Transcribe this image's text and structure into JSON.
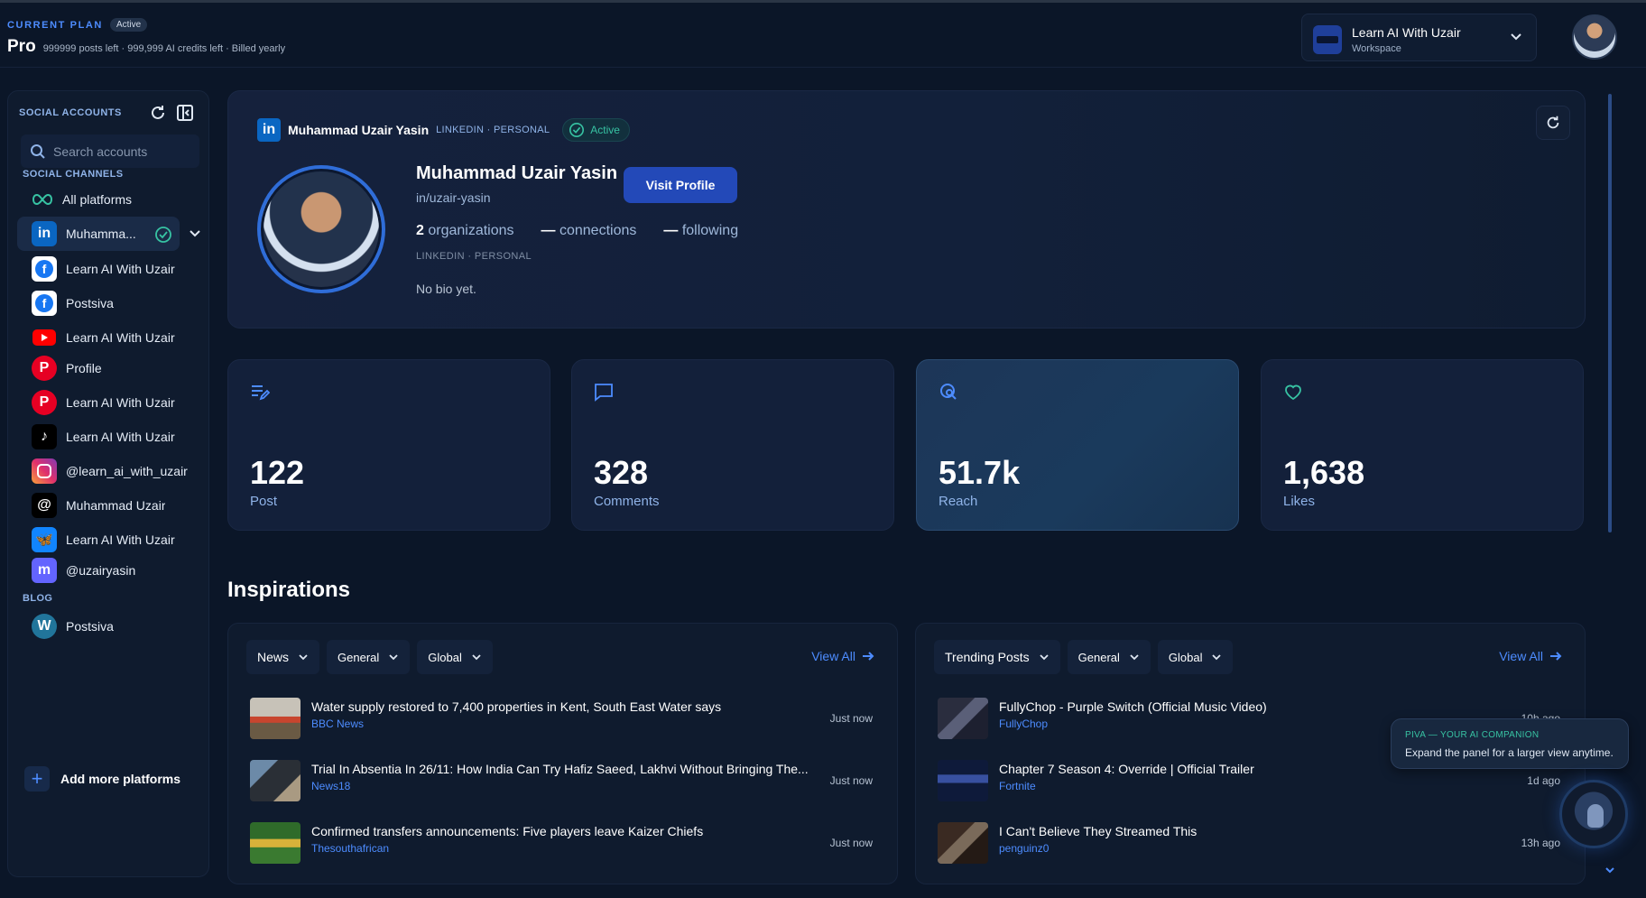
{
  "plan": {
    "eyebrow": "CURRENT PLAN",
    "status": "Active",
    "name": "Pro",
    "meta": "999999 posts left · 999,999 AI credits left · Billed yearly"
  },
  "workspace": {
    "name": "Learn AI With Uzair",
    "label": "Workspace"
  },
  "sidebar": {
    "title": "SOCIAL ACCOUNTS",
    "search_placeholder": "Search accounts",
    "channels_label": "SOCIAL CHANNELS",
    "all_platforms": "All platforms",
    "accounts": [
      {
        "name": "Muhamma...",
        "platform": "linkedin",
        "icon": "linkedin-icon",
        "selected": true
      },
      {
        "name": "Learn AI With Uzair",
        "platform": "facebook",
        "icon": "facebook-icon"
      },
      {
        "name": "Postsiva",
        "platform": "facebook",
        "icon": "facebook-icon"
      },
      {
        "name": "Learn AI With Uzair",
        "platform": "youtube",
        "icon": "youtube-icon"
      },
      {
        "name": "Profile",
        "platform": "pinterest",
        "icon": "pinterest-icon"
      },
      {
        "name": "Learn AI With Uzair",
        "platform": "pinterest",
        "icon": "pinterest-icon"
      },
      {
        "name": "Learn AI With Uzair",
        "platform": "tiktok",
        "icon": "tiktok-icon"
      },
      {
        "name": "@learn_ai_with_uzair",
        "platform": "instagram",
        "icon": "instagram-icon"
      },
      {
        "name": "Muhammad Uzair",
        "platform": "threads",
        "icon": "threads-icon"
      },
      {
        "name": "Learn AI With Uzair",
        "platform": "bluesky",
        "icon": "bluesky-icon"
      },
      {
        "name": "@uzairyasin",
        "platform": "mastodon",
        "icon": "mastodon-icon"
      }
    ],
    "blog_label": "BLOG",
    "blog": [
      {
        "name": "Postsiva",
        "platform": "wordpress",
        "icon": "wordpress-icon"
      }
    ],
    "add_more": "Add more platforms"
  },
  "profile": {
    "header_name": "Muhammad Uzair Yasin",
    "header_kind": "LINKEDIN · PERSONAL",
    "status": "Active",
    "name": "Muhammad Uzair Yasin",
    "handle": "in/uzair-yasin",
    "visit_label": "Visit Profile",
    "org_count": "2",
    "org_label": "organizations",
    "connections_value": "—",
    "connections_label": "connections",
    "following_value": "—",
    "following_label": "following",
    "sub": "LINKEDIN · PERSONAL",
    "bio": "No bio yet."
  },
  "stats": [
    {
      "value": "122",
      "label": "Post",
      "icon": "edit-list-icon"
    },
    {
      "value": "328",
      "label": "Comments",
      "icon": "comment-icon"
    },
    {
      "value": "51.7k",
      "label": "Reach",
      "icon": "reach-icon",
      "highlighted": true
    },
    {
      "value": "1,638",
      "label": "Likes",
      "icon": "heart-icon"
    }
  ],
  "inspirations": {
    "title": "Inspirations",
    "news": {
      "filters": [
        "News",
        "General",
        "Global"
      ],
      "view_all": "View All",
      "items": [
        {
          "title": "Water supply restored to 7,400 properties in Kent, South East Water says",
          "source": "BBC News",
          "time": "Just now"
        },
        {
          "title": "Trial In Absentia In 26/11: How India Can Try Hafiz Saeed, Lakhvi Without Bringing The...",
          "source": "News18",
          "time": "Just now"
        },
        {
          "title": "Confirmed transfers announcements: Five players leave Kaizer Chiefs",
          "source": "Thesouthafrican",
          "time": "Just now"
        }
      ]
    },
    "trending": {
      "filters": [
        "Trending Posts",
        "General",
        "Global"
      ],
      "view_all": "View All",
      "items": [
        {
          "title": "FullyChop - Purple Switch (Official Music Video)",
          "source": "FullyChop",
          "time": "10h ago"
        },
        {
          "title": "Chapter 7 Season 4: Override | Official Trailer",
          "source": "Fortnite",
          "time": "1d ago"
        },
        {
          "title": "I Can't Believe They Streamed This",
          "source": "penguinz0",
          "time": "13h ago"
        }
      ]
    }
  },
  "companion": {
    "title": "PIVA — YOUR AI COMPANION",
    "text": "Expand the panel for a larger view anytime."
  },
  "colors": {
    "background": "#0b1628",
    "accent": "#4d8cff",
    "active_green": "#37c3a3",
    "button": "#2349b8"
  }
}
